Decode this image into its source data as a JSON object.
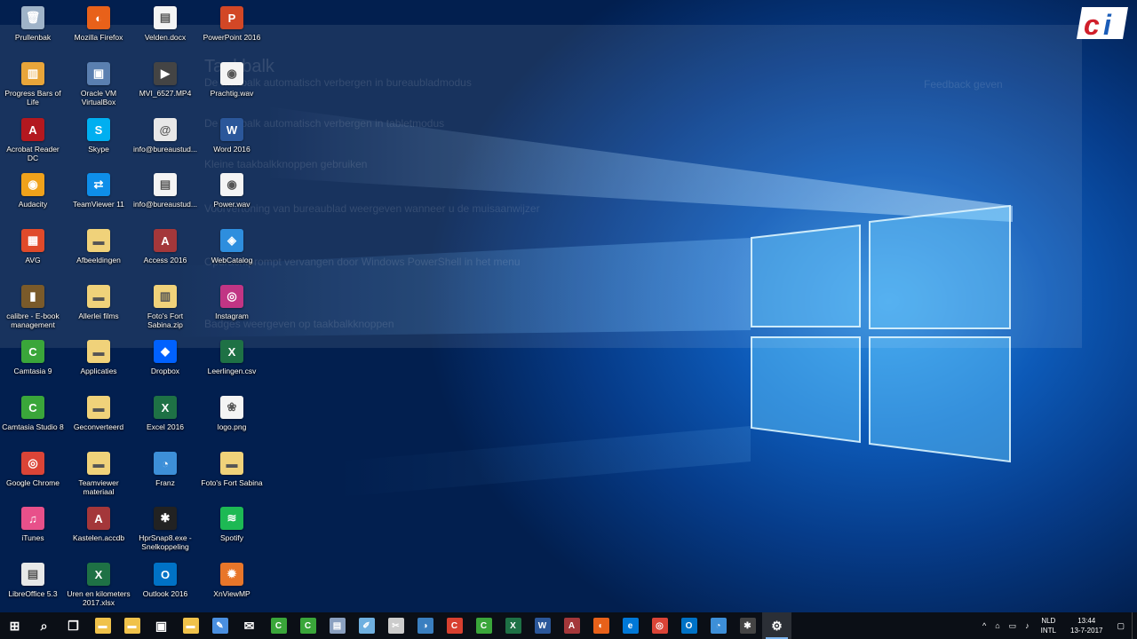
{
  "wallpaper": {
    "accent": "#1a8fff"
  },
  "ghost_window": {
    "title": "Taakbalk",
    "lines": [
      "De taakbalk automatisch verbergen in bureaubladmodus",
      "De taakbalk automatisch verbergen in tabletmodus",
      "Kleine taakbalkknoppen gebruiken",
      "Voorvertoning van bureaublad weergeven wanneer u de muisaanwijzer",
      "Opdrachtprompt vervangen door Windows PowerShell in het menu",
      "Badges weergeven op taakbalkknoppen"
    ],
    "side": "Feedback geven"
  },
  "brand": {
    "text": "ci"
  },
  "desktop_icons": [
    {
      "label": "Prullenbak",
      "icon": "recycle-bin-icon",
      "color": "#9fb3c8",
      "glyph": "🗑"
    },
    {
      "label": "Progress Bars of Life",
      "icon": "progress-bars-icon",
      "color": "#e8a53a",
      "glyph": "▥"
    },
    {
      "label": "Acrobat Reader DC",
      "icon": "acrobat-icon",
      "color": "#b3181f",
      "glyph": "A"
    },
    {
      "label": "Audacity",
      "icon": "audacity-icon",
      "color": "#f0a21b",
      "glyph": "◉"
    },
    {
      "label": "AVG",
      "icon": "avg-icon",
      "color": "#e04a2a",
      "glyph": "▦"
    },
    {
      "label": "calibre - E-book management",
      "icon": "calibre-icon",
      "color": "#7a5a2a",
      "glyph": "▮"
    },
    {
      "label": "Camtasia 9",
      "icon": "camtasia-icon",
      "color": "#3aa63a",
      "glyph": "C"
    },
    {
      "label": "Camtasia Studio 8",
      "icon": "camtasia-icon",
      "color": "#3aa63a",
      "glyph": "C"
    },
    {
      "label": "Google Chrome",
      "icon": "chrome-icon",
      "color": "#db4437",
      "glyph": "◎"
    },
    {
      "label": "iTunes",
      "icon": "itunes-icon",
      "color": "#e8508a",
      "glyph": "♫"
    },
    {
      "label": "LibreOffice 5.3",
      "icon": "libreoffice-icon",
      "color": "#e8e8e8",
      "glyph": "▤"
    },
    {
      "label": "Mozilla Firefox",
      "icon": "firefox-icon",
      "color": "#e8611a",
      "glyph": "◐"
    },
    {
      "label": "Oracle VM VirtualBox",
      "icon": "virtualbox-icon",
      "color": "#5a7fb0",
      "glyph": "▣"
    },
    {
      "label": "Skype",
      "icon": "skype-icon",
      "color": "#00aff0",
      "glyph": "S"
    },
    {
      "label": "TeamViewer 11",
      "icon": "teamviewer-icon",
      "color": "#0e8ee9",
      "glyph": "⇄"
    },
    {
      "label": "Afbeeldingen",
      "icon": "folder-icon",
      "color": "#f0d27a",
      "glyph": "▬"
    },
    {
      "label": "Allerlei films",
      "icon": "folder-icon",
      "color": "#f0d27a",
      "glyph": "▬"
    },
    {
      "label": "Applicaties",
      "icon": "folder-icon",
      "color": "#f0d27a",
      "glyph": "▬"
    },
    {
      "label": "Geconverteerd",
      "icon": "folder-icon",
      "color": "#f0d27a",
      "glyph": "▬"
    },
    {
      "label": "Teamviewer materiaal",
      "icon": "folder-icon",
      "color": "#f0d27a",
      "glyph": "▬"
    },
    {
      "label": "Kastelen.accdb",
      "icon": "access-file-icon",
      "color": "#a4373a",
      "glyph": "A"
    },
    {
      "label": "Uren en kilometers 2017.xlsx",
      "icon": "excel-file-icon",
      "color": "#1e7145",
      "glyph": "X"
    },
    {
      "label": "Velden.docx",
      "icon": "document-icon",
      "color": "#f4f4f4",
      "glyph": "▤"
    },
    {
      "label": "MVI_6527.MP4",
      "icon": "video-file-icon",
      "color": "#444444",
      "glyph": "▶"
    },
    {
      "label": "info@bureaustud...",
      "icon": "contact-file-icon",
      "color": "#e8e8e8",
      "glyph": "@"
    },
    {
      "label": "info@bureaustud...",
      "icon": "document-icon",
      "color": "#f4f4f4",
      "glyph": "▤"
    },
    {
      "label": "Access 2016",
      "icon": "access-icon",
      "color": "#a4373a",
      "glyph": "A"
    },
    {
      "label": "Foto's Fort Sabina.zip",
      "icon": "zip-folder-icon",
      "color": "#f0d27a",
      "glyph": "▥"
    },
    {
      "label": "Dropbox",
      "icon": "dropbox-icon",
      "color": "#0061ff",
      "glyph": "◆"
    },
    {
      "label": "Excel 2016",
      "icon": "excel-icon",
      "color": "#1e7145",
      "glyph": "X"
    },
    {
      "label": "Franz",
      "icon": "franz-icon",
      "color": "#3d8fd8",
      "glyph": "◔"
    },
    {
      "label": "HprSnap8.exe - Snelkoppeling",
      "icon": "hypersnap-icon",
      "color": "#222222",
      "glyph": "✱"
    },
    {
      "label": "Outlook 2016",
      "icon": "outlook-icon",
      "color": "#0072c6",
      "glyph": "O"
    },
    {
      "label": "PowerPoint 2016",
      "icon": "powerpoint-icon",
      "color": "#d24726",
      "glyph": "P"
    },
    {
      "label": "Prachtig.wav",
      "icon": "audio-file-icon",
      "color": "#f4f4f4",
      "glyph": "◉"
    },
    {
      "label": "Word 2016",
      "icon": "word-icon",
      "color": "#2b579a",
      "glyph": "W"
    },
    {
      "label": "Power.wav",
      "icon": "audio-file-icon",
      "color": "#f4f4f4",
      "glyph": "◉"
    },
    {
      "label": "WebCatalog",
      "icon": "webcatalog-icon",
      "color": "#2e8ede",
      "glyph": "◈"
    },
    {
      "label": "Instagram",
      "icon": "instagram-icon",
      "color": "#c13584",
      "glyph": "◎"
    },
    {
      "label": "Leerlingen.csv",
      "icon": "csv-file-icon",
      "color": "#1e7145",
      "glyph": "X"
    },
    {
      "label": "logo.png",
      "icon": "image-file-icon",
      "color": "#f4f4f4",
      "glyph": "❀"
    },
    {
      "label": "Foto's Fort Sabina",
      "icon": "folder-icon",
      "color": "#f0d27a",
      "glyph": "▬"
    },
    {
      "label": "Spotify",
      "icon": "spotify-icon",
      "color": "#1db954",
      "glyph": "≋"
    },
    {
      "label": "XnViewMP",
      "icon": "xnview-icon",
      "color": "#e8762a",
      "glyph": "✹"
    }
  ],
  "taskbar": {
    "items": [
      {
        "icon": "start-icon",
        "glyph": "⊞",
        "color": "transparent"
      },
      {
        "icon": "search-icon",
        "glyph": "⌕",
        "color": "transparent"
      },
      {
        "icon": "task-view-icon",
        "glyph": "❐",
        "color": "transparent"
      },
      {
        "icon": "file-explorer-icon",
        "glyph": "▬",
        "color": "#f0c24a"
      },
      {
        "icon": "folder-icon",
        "glyph": "▬",
        "color": "#f0c24a"
      },
      {
        "icon": "store-icon",
        "glyph": "▣",
        "color": "transparent"
      },
      {
        "icon": "folder-icon",
        "glyph": "▬",
        "color": "#f0c24a"
      },
      {
        "icon": "pin-app-icon",
        "glyph": "✎",
        "color": "#4a8fe0"
      },
      {
        "icon": "mail-icon",
        "glyph": "✉",
        "color": "transparent"
      },
      {
        "icon": "camtasia-icon",
        "glyph": "C",
        "color": "#3aa63a"
      },
      {
        "icon": "camtasia-icon",
        "glyph": "C",
        "color": "#3aa63a"
      },
      {
        "icon": "notes-icon",
        "glyph": "▤",
        "color": "#8aa0c0"
      },
      {
        "icon": "pen-icon",
        "glyph": "✐",
        "color": "#6fb0e0"
      },
      {
        "icon": "snip-icon",
        "glyph": "✂",
        "color": "#cccccc"
      },
      {
        "icon": "globe-icon",
        "glyph": "◑",
        "color": "#3a7fc0"
      },
      {
        "icon": "camtasia-recorder-icon",
        "glyph": "C",
        "color": "#d8402f"
      },
      {
        "icon": "camtasia-icon",
        "glyph": "C",
        "color": "#3aa63a"
      },
      {
        "icon": "excel-icon",
        "glyph": "X",
        "color": "#1e7145"
      },
      {
        "icon": "word-icon",
        "glyph": "W",
        "color": "#2b579a"
      },
      {
        "icon": "access-icon",
        "glyph": "A",
        "color": "#a4373a"
      },
      {
        "icon": "firefox-icon",
        "glyph": "◐",
        "color": "#e8611a"
      },
      {
        "icon": "edge-icon",
        "glyph": "e",
        "color": "#0078d7"
      },
      {
        "icon": "chrome-icon",
        "glyph": "◎",
        "color": "#db4437"
      },
      {
        "icon": "outlook-icon",
        "glyph": "O",
        "color": "#0072c6"
      },
      {
        "icon": "franz-icon",
        "glyph": "◔",
        "color": "#3d8fd8"
      },
      {
        "icon": "hypersnap-icon",
        "glyph": "✱",
        "color": "#444444"
      },
      {
        "icon": "settings-icon",
        "glyph": "⚙",
        "color": "transparent",
        "active": true
      }
    ],
    "tray": {
      "chevron": "^",
      "language_top": "NLD",
      "language_bottom": "INTL",
      "time": "13:44",
      "date": "13-7-2017"
    }
  }
}
